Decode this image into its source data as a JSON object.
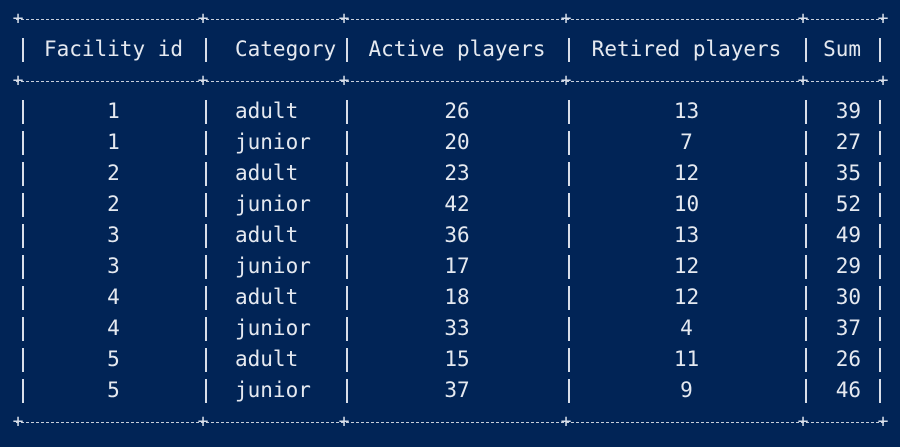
{
  "table": {
    "headers": [
      "Facility id",
      "Category",
      "Active players",
      "Retired players",
      "Sum"
    ],
    "rows": [
      [
        "1",
        "adult",
        "26",
        "13",
        "39"
      ],
      [
        "1",
        "junior",
        "20",
        "7",
        "27"
      ],
      [
        "2",
        "adult",
        "23",
        "12",
        "35"
      ],
      [
        "2",
        "junior",
        "42",
        "10",
        "52"
      ],
      [
        "3",
        "adult",
        "36",
        "13",
        "49"
      ],
      [
        "3",
        "junior",
        "17",
        "12",
        "29"
      ],
      [
        "4",
        "adult",
        "18",
        "12",
        "30"
      ],
      [
        "4",
        "junior",
        "33",
        "4",
        "37"
      ],
      [
        "5",
        "adult",
        "15",
        "11",
        "26"
      ],
      [
        "5",
        "junior",
        "37",
        "9",
        "46"
      ]
    ]
  },
  "colors": {
    "background": "#012456",
    "text": "#e5e9f0",
    "border": "#d8dee9"
  }
}
